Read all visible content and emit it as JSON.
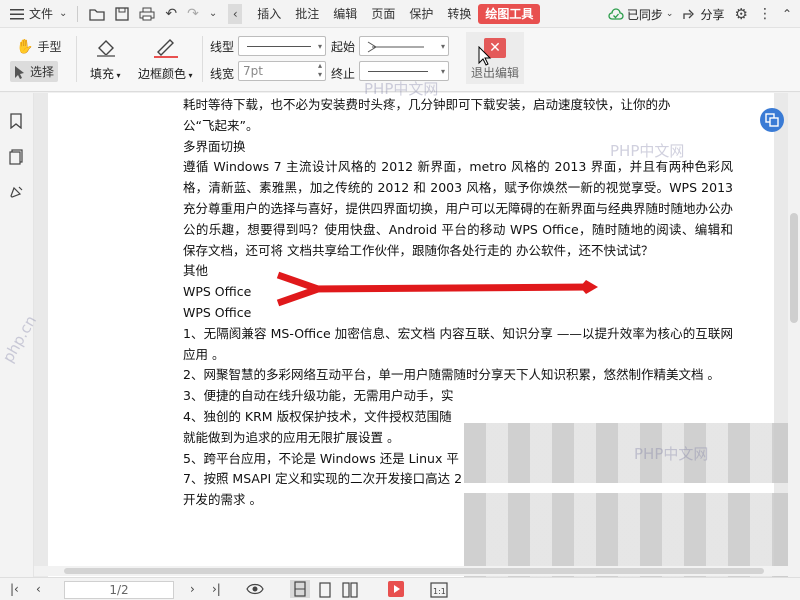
{
  "menubar": {
    "file_label": "文件",
    "tabs": [
      "插入",
      "批注",
      "编辑",
      "页面",
      "保护",
      "转换",
      "绘图工具"
    ],
    "sync_label": "已同步",
    "share_label": "分享"
  },
  "ribbon": {
    "hand_label": "手型",
    "select_label": "选择",
    "fill_label": "填充",
    "border_color_label": "边框颜色",
    "line_type_label": "线型",
    "line_width_label": "线宽",
    "line_width_value": "7pt",
    "start_label": "起始",
    "end_label": "终止",
    "exit_label": "退出编辑",
    "accent_color": "#e8504f"
  },
  "document": {
    "paragraphs": [
      "耗时等待下载，也不必为安装费时头疼，几分钟即可下载安装，启动速度较快，让你的办",
      "公“飞起来”。",
      "多界面切换",
      "遵循 Windows 7 主流设计风格的 2012 新界面，metro 风格的 2013 界面，并且有两种色彩风格，清新蓝、素雅黑，加之传统的 2012 和 2003 风格，赋予你焕然一新的视觉享受。WPS 2013 充分尊重用户的选择与喜好，提供四界面切换，用户可以无障碍的在新界面与经典界随时随地办公办公的乐趣，想要得到吗？使用快盘、Android 平台的移动 WPS Office，随时随地的阅读、编辑和 保存文档，还可将 文档共享给工作伙伴，跟随你各处行走的 办公软件，还不快试试？",
      "其他",
      "WPS Office",
      "WPS Office",
      "1、无隔阂兼容 MS-Office 加密信息、宏文档 内容互联、知识分享 ——以提升效率为核心的互联网应用 。",
      "2、网聚智慧的多彩网络互动平台，单一用户随需随时分享天下人知识积累，悠然制作精美文档 。",
      "3、便捷的自动在线升级功能，无需用户动手，实",
      "4、独创的 KRM 版权保护技术，文件授权范围随",
      "就能做到为追求的应用无限扩展设置 。",
      "5、跨平台应用，不论是 Windows 还是 Linux 平",
      "7、按照 MSAPI 定义和实现的二次开发接口高达 2",
      "开发的需求 。"
    ]
  },
  "statusbar": {
    "page_indicator": "1/2"
  },
  "watermarks": [
    "PHP中文网",
    "PHP中文网",
    "PHP中文网",
    "php.cn"
  ],
  "arrow_color": "#e0191b"
}
